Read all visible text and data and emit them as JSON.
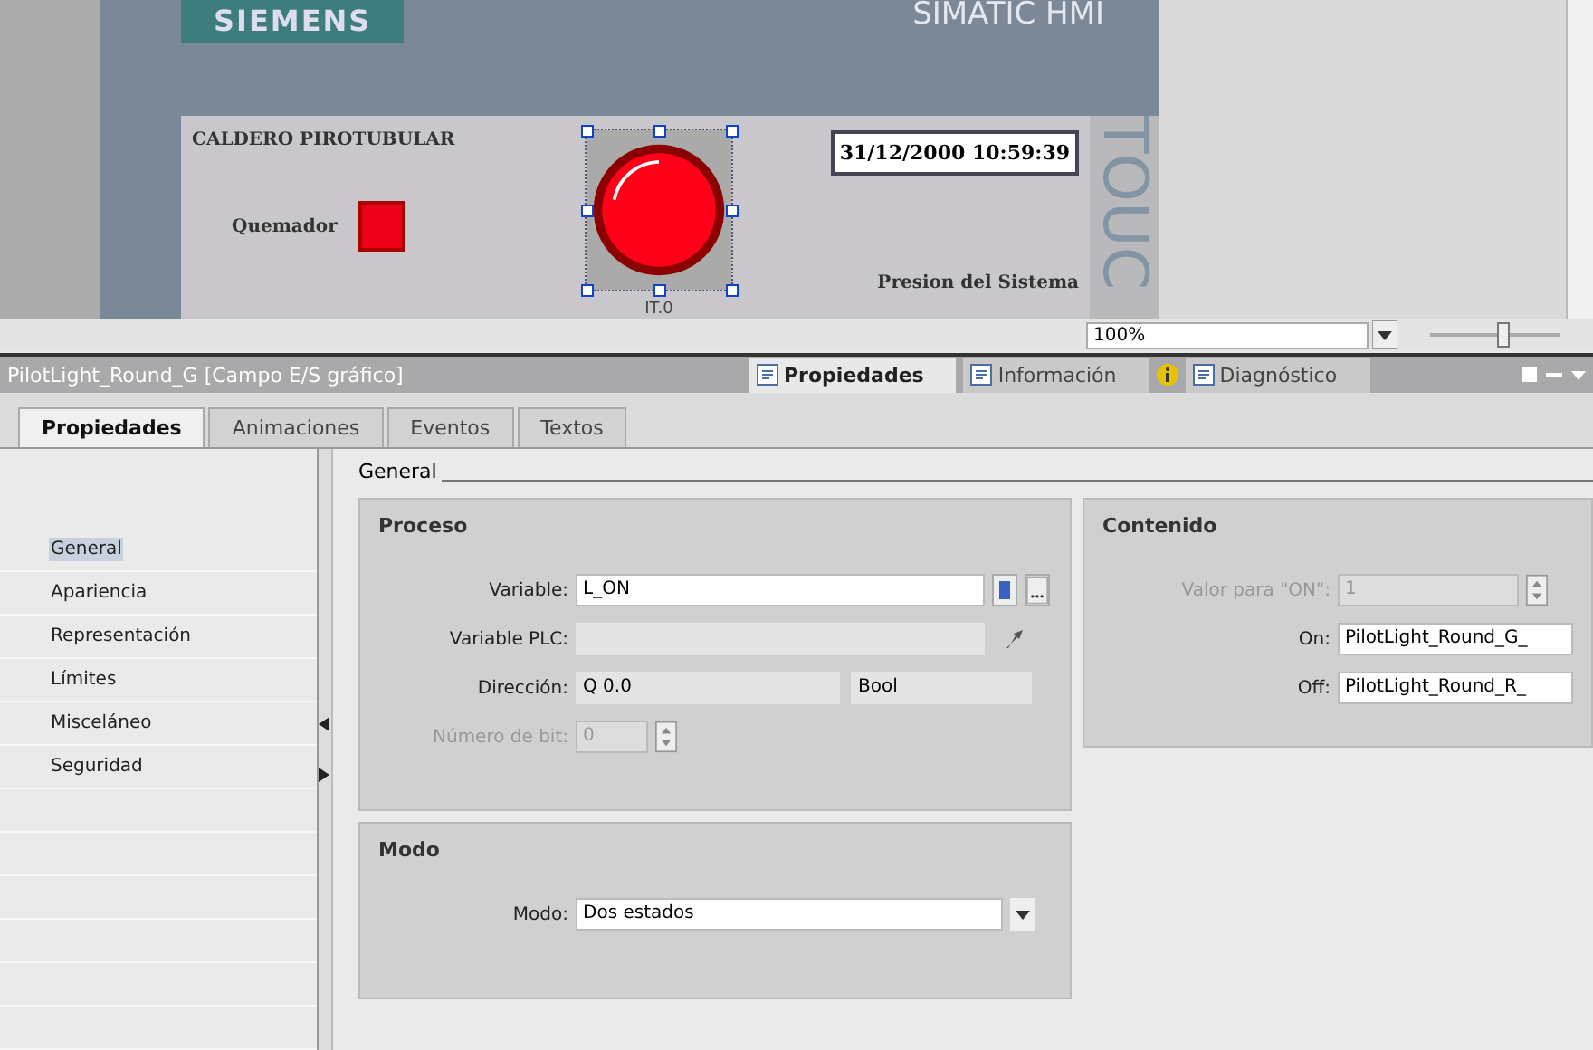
{
  "hmi": {
    "brand": "SIEMENS",
    "product": "SIMATIC HMI",
    "side_text": "TOUC",
    "screen_title": "CALDERO PIROTUBULAR",
    "datetime": "31/12/2000 10:59:39",
    "burner_label": "Quemador",
    "pressure_label": "Presion del  Sistema",
    "light_tag": "IT.0",
    "light_selected": true
  },
  "zoom": {
    "value": "100%",
    "level": 0.55
  },
  "inspector": {
    "title": "PilotLight_Round_G [Campo E/S gráfico]",
    "view_tabs": [
      {
        "label": "Propiedades",
        "selected": true
      },
      {
        "label": "Información",
        "selected": false,
        "info_badge": true
      },
      {
        "label": "Diagnóstico",
        "selected": false
      }
    ],
    "tabs": [
      {
        "label": "Propiedades",
        "selected": true
      },
      {
        "label": "Animaciones",
        "selected": false
      },
      {
        "label": "Eventos",
        "selected": false
      },
      {
        "label": "Textos",
        "selected": false
      }
    ],
    "nav": [
      {
        "label": "General",
        "selected": true
      },
      {
        "label": "Apariencia",
        "selected": false
      },
      {
        "label": "Representación",
        "selected": false
      },
      {
        "label": "Límites",
        "selected": false
      },
      {
        "label": "Misceláneo",
        "selected": false
      },
      {
        "label": "Seguridad",
        "selected": false
      }
    ],
    "section": "General",
    "groups": [
      {
        "title": "Proceso",
        "fields": [
          {
            "label": "Variable:",
            "kind": "variable",
            "value": "L_ON",
            "disabled": false
          },
          {
            "label": "Variable PLC:",
            "kind": "readonly",
            "disabled": false
          },
          {
            "label": "Dirección:",
            "kind": "address",
            "value": "Q 0.0",
            "type": "Bool",
            "disabled": false
          },
          {
            "label": "Número de bit:",
            "kind": "spin",
            "value": "0",
            "disabled": true
          }
        ]
      },
      {
        "title": "Contenido",
        "fields": [
          {
            "label": "Valor para \"ON\":",
            "kind": "spin",
            "value": "1",
            "disabled": true
          },
          {
            "label": "On:",
            "kind": "text",
            "value": "PilotLight_Round_G_",
            "disabled": false
          },
          {
            "label": "Off:",
            "kind": "text",
            "value": "PilotLight_Round_R_",
            "disabled": false
          }
        ]
      },
      {
        "title": "Modo",
        "fields": [
          {
            "label": "Modo:",
            "kind": "select",
            "value": "Dos estados",
            "disabled": false
          }
        ]
      }
    ]
  }
}
